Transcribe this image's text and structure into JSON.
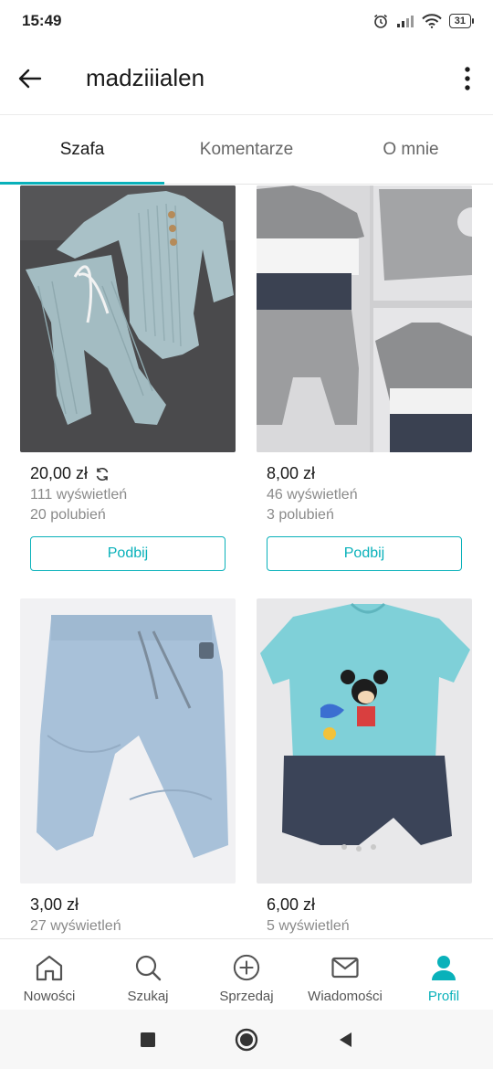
{
  "status": {
    "time": "15:49",
    "battery": "31"
  },
  "header": {
    "title": "madziiialen"
  },
  "tabs": [
    {
      "label": "Szafa",
      "active": true
    },
    {
      "label": "Komentarze",
      "active": false
    },
    {
      "label": "O mnie",
      "active": false
    }
  ],
  "items": [
    {
      "price": "20,00 zł",
      "views": "111 wyświetleń",
      "likes": "20 polubień",
      "button": "Podbij",
      "photo": "blue ribbed bodysuit and pants",
      "icon": "refresh-icon"
    },
    {
      "price": "8,00 zł",
      "views": "46 wyświetleń",
      "likes": "3 polubień",
      "button": "Podbij",
      "photo": "grey sweatshirt and pants set"
    },
    {
      "price": "3,00 zł",
      "views": "27 wyświetleń",
      "photo": "light blue jogger pants"
    },
    {
      "price": "6,00 zł",
      "views": "5 wyświetleń",
      "photo": "mickey mouse romper"
    }
  ],
  "bottom_nav": [
    {
      "label": "Nowości",
      "icon": "home-icon",
      "active": false
    },
    {
      "label": "Szukaj",
      "icon": "search-icon",
      "active": false
    },
    {
      "label": "Sprzedaj",
      "icon": "plus-circle-icon",
      "active": false
    },
    {
      "label": "Wiadomości",
      "icon": "mail-icon",
      "active": false
    },
    {
      "label": "Profil",
      "icon": "person-icon",
      "active": true
    }
  ],
  "colors": {
    "accent": "#09b1ba",
    "text": "#1a1a1a",
    "muted": "#8a8a8a"
  }
}
